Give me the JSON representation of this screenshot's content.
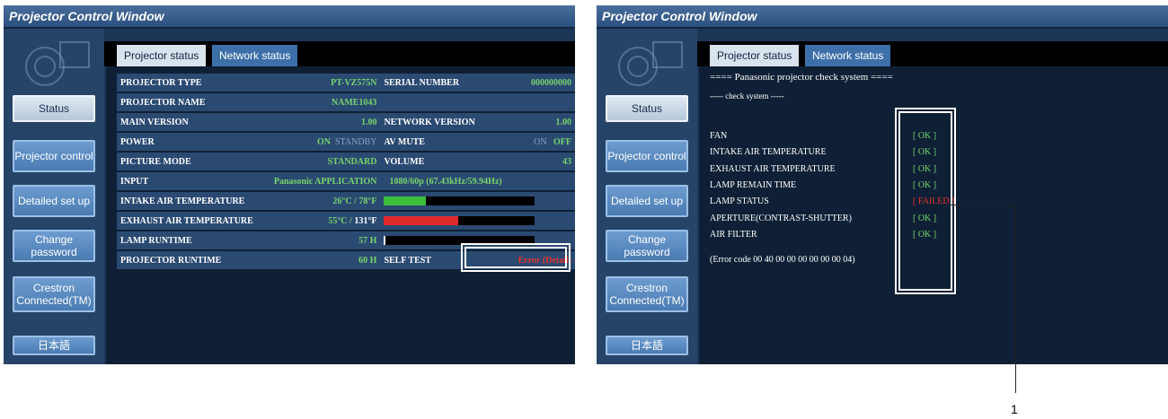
{
  "left": {
    "title": "Projector Control Window",
    "nav": [
      "Status",
      "Projector control",
      "Detailed set up",
      "Change password",
      "Crestron Connected(TM)",
      "日本語"
    ],
    "tabs": [
      "Projector status",
      "Network status"
    ],
    "rows": {
      "projector_type": {
        "label": "PROJECTOR TYPE",
        "value": "PT-VZ575N"
      },
      "serial_number": {
        "label": "SERIAL NUMBER",
        "value": "000000000"
      },
      "projector_name": {
        "label": "PROJECTOR NAME",
        "value": "NAME1043"
      },
      "main_version": {
        "label": "MAIN VERSION",
        "value": "1.00"
      },
      "network_version": {
        "label": "NETWORK VERSION",
        "value": "1.00"
      },
      "power": {
        "label": "POWER",
        "on": "ON",
        "standby": "STANDBY"
      },
      "av_mute": {
        "label": "AV MUTE",
        "on": "ON",
        "off": "OFF"
      },
      "picture_mode": {
        "label": "PICTURE MODE",
        "value": "STANDARD"
      },
      "volume": {
        "label": "VOLUME",
        "value": "43"
      },
      "input": {
        "label": "INPUT",
        "value": "Panasonic APPLICATION",
        "signal": "1080/60p (67.43kHz/59.94Hz)"
      },
      "intake_temp": {
        "label": "INTAKE AIR TEMPERATURE",
        "value": "26°C / 78°F",
        "level": 0.28,
        "color": "#3cbf3c"
      },
      "exhaust_temp": {
        "label": "EXHAUST AIR TEMPERATURE",
        "value_c": "55°C",
        "value_f": "131°F",
        "level": 0.49,
        "color": "#e02a2a"
      },
      "lamp_runtime": {
        "label": "LAMP RUNTIME",
        "value": "57 H"
      },
      "projector_runtime": {
        "label": "PROJECTOR RUNTIME",
        "value": "60 H"
      },
      "self_test": {
        "label": "SELF TEST",
        "error": "Error",
        "sep": "(",
        "detail": "Detail",
        "end": ")"
      }
    }
  },
  "right": {
    "title": "Projector Control Window",
    "nav": [
      "Status",
      "Projector control",
      "Detailed set up",
      "Change password",
      "Crestron Connected(TM)",
      "日本語"
    ],
    "tabs": [
      "Projector status",
      "Network status"
    ],
    "header": "==== Panasonic projector check system ====",
    "subheader": "----- check system -----",
    "checks": [
      {
        "label": "FAN",
        "result": "[ OK ]"
      },
      {
        "label": "INTAKE AIR TEMPERATURE",
        "result": "[ OK ]"
      },
      {
        "label": "EXHAUST AIR TEMPERATURE",
        "result": "[ OK ]"
      },
      {
        "label": "LAMP REMAIN TIME",
        "result": "[ OK ]"
      },
      {
        "label": "LAMP STATUS",
        "result": "[ FAILED ]"
      },
      {
        "label": "APERTURE(CONTRAST-SHUTTER)",
        "result": "[ OK ]"
      },
      {
        "label": "AIR FILTER",
        "result": "[ OK ]"
      }
    ],
    "error_code": "(Error code 00 40 00 00 00 00 00 00 04)"
  },
  "callout": "1"
}
